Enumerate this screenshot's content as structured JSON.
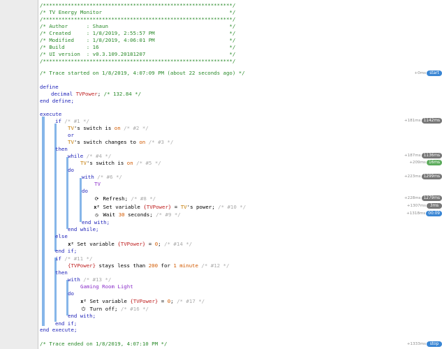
{
  "header": [
    "/*************************************************************/",
    "/* TV Energy Monitor                                         */",
    "/*************************************************************/",
    "/* Author      : Shaun                                       */",
    "/* Created     : 1/8/2019, 2:55:57 PM                        */",
    "/* Modified    : 1/8/2019, 4:06:01 PM                        */",
    "/* Build       : 16                                          */",
    "/* UI version  : v0.3.109.20181207                           */",
    "/*************************************************************/"
  ],
  "trace_start": "/* Trace started on 1/8/2019, 4:07:09 PM (about 22 seconds ago) */",
  "trace_end": "/* Trace ended on 1/8/2019, 4:07:10 PM */",
  "kw": {
    "define": "define",
    "decimal": "decimal",
    "end_define": "end define;",
    "execute": "execute",
    "if": "if",
    "or": "or",
    "then": "then",
    "while": "while",
    "do": "do",
    "with": "with",
    "end_with": "end with;",
    "end_while": "end while;",
    "else": "else",
    "end_if": "end if;",
    "end_execute": "end execute;",
    "set_variable": "Set variable",
    "refresh": "Refresh;",
    "wait": "Wait",
    "seconds": "seconds;",
    "turn_off": "Turn off;",
    "stays_less": "stays less than",
    "for": "for",
    "minute": "minute",
    "switch_is": "'s switch is",
    "switch_changes": "'s switch changes to",
    "power": "'s power;"
  },
  "vars": {
    "tv_power": "TVPower",
    "tv_power_ref": "{TVPower}"
  },
  "devices": {
    "tv": "TV",
    "gaming_light": "Gaming Room Light"
  },
  "values": {
    "on": "on",
    "zero": "0",
    "thirty": "30",
    "two_hundred": "200",
    "one": "1",
    "tv_power_value": "/* 132.84 */"
  },
  "comments": {
    "c1": "/* #1 */",
    "c2": "/* #2 */",
    "c3": "/* #3 */",
    "c4": "/* #4 */",
    "c5": "/* #5 */",
    "c6": "/* #6 */",
    "c8": "/* #8 */",
    "c9": "/* #9 */",
    "c10": "/* #10 */",
    "c11": "/* #11 */",
    "c12": "/* #12 */",
    "c13": "/* #13 */",
    "c14": "/* #14 */",
    "c16": "/* #16 */",
    "c17": "/* #17 */"
  },
  "gutter": [
    {
      "label": "+0ms",
      "badge": "start",
      "color": "blue"
    },
    {
      "label": "+181ms",
      "badge": "1142ms",
      "color": "gray"
    },
    {
      "label": "+187ms",
      "badge": "1136ms",
      "color": "gray"
    },
    {
      "label": "+209ms",
      "badge": "16ms",
      "color": "green"
    },
    {
      "label": "+223ms",
      "badge": "1299ms",
      "color": "gray"
    },
    {
      "label": "+228ms",
      "badge": "1279ms",
      "color": "gray"
    },
    {
      "label": "+1307ms",
      "badge": "3ms",
      "color": "gray"
    },
    {
      "label": "+1318ms",
      "badge": "00:09",
      "color": "blue"
    },
    {
      "label": "+1333ms",
      "badge": "stop",
      "color": "blue"
    }
  ]
}
